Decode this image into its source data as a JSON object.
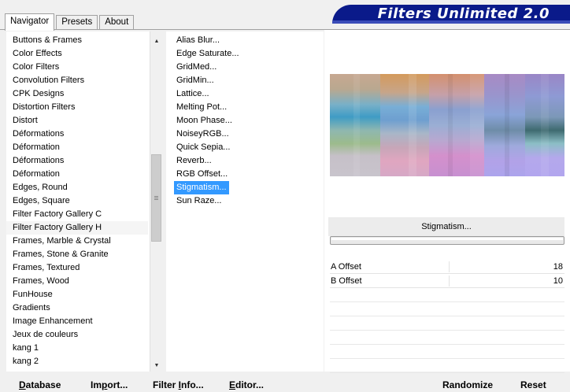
{
  "tabs": [
    {
      "label": "Navigator"
    },
    {
      "label": "Presets"
    },
    {
      "label": "About"
    }
  ],
  "banner": {
    "title": "Filters Unlimited 2.0"
  },
  "categories": [
    "Buttons & Frames",
    "Color Effects",
    "Color Filters",
    "Convolution Filters",
    "CPK Designs",
    "Distortion Filters",
    "Distort",
    "Déformations",
    "Déformation",
    "Déformations",
    "Déformation",
    "Edges, Round",
    "Edges, Square",
    "Filter Factory Gallery C",
    "Filter Factory Gallery H",
    "Frames, Marble & Crystal",
    "Frames, Stone & Granite",
    "Frames, Textured",
    "Frames, Wood",
    "FunHouse",
    "Gradients",
    "Image Enhancement",
    "Jeux de couleurs",
    "kang 1",
    "kang 2"
  ],
  "filters": [
    "Alias Blur...",
    "Edge Saturate...",
    "GridMed...",
    "GridMin...",
    "Lattice...",
    "Melting Pot...",
    "Moon Phase...",
    "NoiseyRGB...",
    "Quick Sepia...",
    "Reverb...",
    "RGB Offset...",
    "Stigmatism...",
    "Sun Raze..."
  ],
  "selected_filter": "Stigmatism...",
  "params": [
    {
      "label": "A Offset",
      "value": "18"
    },
    {
      "label": "B Offset",
      "value": "10"
    }
  ],
  "buttons": {
    "database_u": "D",
    "database_rest": "atabase",
    "import_pre": "Im",
    "import_u": "p",
    "import_rest": "ort...",
    "filterinfo_pre": "Filter ",
    "filterinfo_u": "I",
    "filterinfo_rest": "nfo...",
    "editor_u": "E",
    "editor_rest": "ditor...",
    "randomize": "Randomize",
    "reset": "Reset"
  },
  "colors": {
    "banner_bg": "#0a1a8a",
    "selection": "#3399ff"
  }
}
